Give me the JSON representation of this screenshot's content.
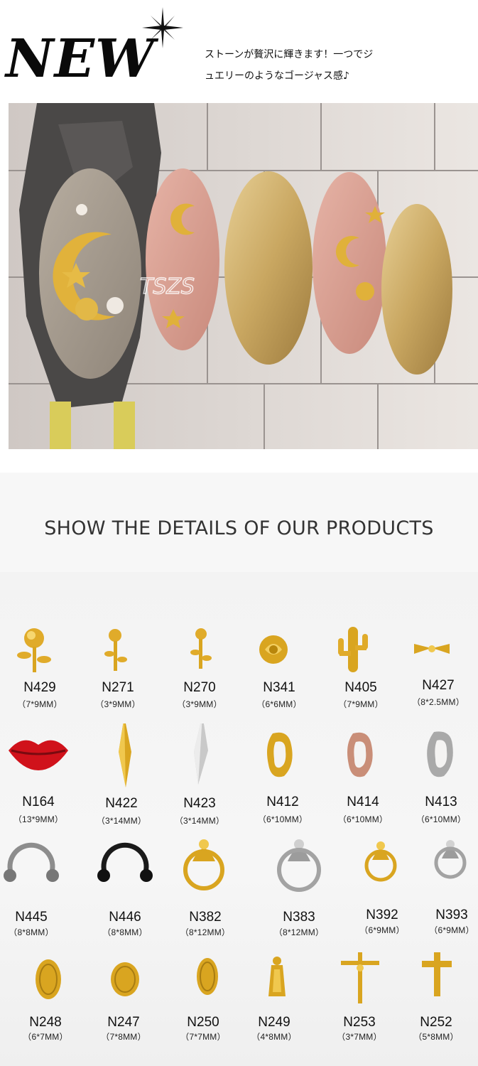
{
  "header": {
    "title": "NEW",
    "tagline_line1": "ストーンが贅沢に輝きます！一つでジ",
    "tagline_line2": "ュエリーのようなゴージャス感♪"
  },
  "photo": {
    "subject": "nail-art-photo",
    "watermark": "TSZS"
  },
  "details": {
    "title": "SHOW THE DETAILS OF OUR PRODUCTS"
  },
  "colors": {
    "gold": "#d9a520",
    "silver": "#b8b8b8",
    "red": "#d0121b",
    "black": "#1a1a1a",
    "rose_gold": "#c98e78"
  },
  "products": [
    {
      "code": "N429",
      "size": "（7*9MM）",
      "icon": "rose-charm-icon"
    },
    {
      "code": "N271",
      "size": "（3*9MM）",
      "icon": "rose-charm-icon"
    },
    {
      "code": "N270",
      "size": "（3*9MM）",
      "icon": "rose-charm-icon"
    },
    {
      "code": "N341",
      "size": "（6*6MM）",
      "icon": "rose-head-icon"
    },
    {
      "code": "N405",
      "size": "（7*9MM）",
      "icon": "cactus-icon"
    },
    {
      "code": "N427",
      "size": "（8*2.5MM）",
      "icon": "bow-icon"
    },
    {
      "code": "N164",
      "size": "（13*9MM）",
      "icon": "lips-icon"
    },
    {
      "code": "N422",
      "size": "（3*14MM）",
      "icon": "spike-icon"
    },
    {
      "code": "N423",
      "size": "（3*14MM）",
      "icon": "spike-icon"
    },
    {
      "code": "N412",
      "size": "（6*10MM）",
      "icon": "hoop-icon"
    },
    {
      "code": "N414",
      "size": "（6*10MM）",
      "icon": "hoop-icon"
    },
    {
      "code": "N413",
      "size": "（6*10MM）",
      "icon": "hoop-icon"
    },
    {
      "code": "N445",
      "size": "（8*8MM）",
      "icon": "horseshoe-ring-icon"
    },
    {
      "code": "N446",
      "size": "（8*8MM）",
      "icon": "horseshoe-ring-icon"
    },
    {
      "code": "N382",
      "size": "（8*12MM）",
      "icon": "door-knocker-icon"
    },
    {
      "code": "N383",
      "size": "（8*12MM）",
      "icon": "door-knocker-icon"
    },
    {
      "code": "N392",
      "size": "（6*9MM）",
      "icon": "door-knocker-icon"
    },
    {
      "code": "N393",
      "size": "（6*9MM）",
      "icon": "door-knocker-icon"
    },
    {
      "code": "N248",
      "size": "（6*7MM）",
      "icon": "medal-icon"
    },
    {
      "code": "N247",
      "size": "（7*8MM）",
      "icon": "medal-icon"
    },
    {
      "code": "N250",
      "size": "（7*7MM）",
      "icon": "medal-icon"
    },
    {
      "code": "N249",
      "size": "（4*8MM）",
      "icon": "virgin-mary-icon"
    },
    {
      "code": "N253",
      "size": "（3*7MM）",
      "icon": "crucifix-icon"
    },
    {
      "code": "N252",
      "size": "（5*8MM）",
      "icon": "cross-icon"
    }
  ]
}
